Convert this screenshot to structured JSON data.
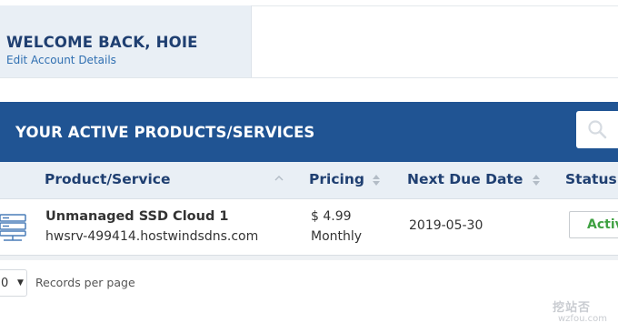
{
  "welcome": {
    "title": "WELCOME BACK, HOIE",
    "edit_link": "Edit Account Details"
  },
  "products": {
    "title": "YOUR ACTIVE PRODUCTS/SERVICES",
    "search_icon": "search-icon",
    "columns": {
      "product": "Product/Service",
      "pricing": "Pricing",
      "next_due": "Next Due Date",
      "status": "Status"
    },
    "rows": [
      {
        "icon": "server-icon",
        "name": "Unmanaged SSD Cloud 1",
        "domain": "hwsrv-499414.hostwindsdns.com",
        "price": "$ 4.99",
        "cycle": "Monthly",
        "due": "2019-05-30",
        "status": "Activ"
      }
    ],
    "page_size": "0",
    "records_label": "Records per page"
  },
  "watermark": {
    "logo": "挖站否",
    "url": "wzfou.com"
  },
  "colors": {
    "header_blue": "#205493",
    "heading_text": "#1f3f71",
    "link_blue": "#2f6fb1",
    "status_green": "#3fa142",
    "panel_bg": "#e9eff5"
  }
}
